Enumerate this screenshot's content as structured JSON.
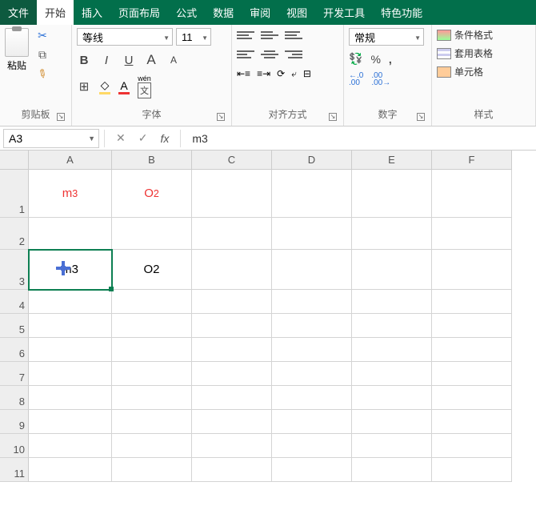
{
  "menu": {
    "file": "文件",
    "tabs": [
      "开始",
      "插入",
      "页面布局",
      "公式",
      "数据",
      "审阅",
      "视图",
      "开发工具",
      "特色功能"
    ],
    "active": 0
  },
  "ribbon": {
    "clipboard": {
      "paste": "粘贴",
      "label": "剪贴板"
    },
    "font": {
      "name": "等线",
      "size": "11",
      "label": "字体",
      "bold": "B",
      "italic": "I",
      "underline": "U",
      "wen": "wén",
      "wen2": "文"
    },
    "align": {
      "label": "对齐方式"
    },
    "number": {
      "format": "常规",
      "label": "数字",
      "percent": "%",
      "comma": ",",
      "p1": ".0",
      "p2": ".00",
      "a1": "←.0",
      "a2": ".00→"
    },
    "styles": {
      "label": "样式",
      "cond": "条件格式",
      "table": "套用表格",
      "cell": "单元格"
    }
  },
  "formula_bar": {
    "ref": "A3",
    "fx": "fx",
    "value": "m3"
  },
  "grid": {
    "cols": [
      "A",
      "B",
      "C",
      "D",
      "E",
      "F"
    ],
    "rows": [
      "1",
      "2",
      "3",
      "4",
      "5",
      "6",
      "7",
      "8",
      "9",
      "10",
      "11"
    ],
    "cells": {
      "A1": {
        "base": "m",
        "sup": "3",
        "cls": "red"
      },
      "B1": {
        "base": "O",
        "sub": "2",
        "cls": "red"
      },
      "A3": {
        "text": "m3"
      },
      "B3": {
        "text": "O2"
      }
    },
    "selected": "A3"
  }
}
